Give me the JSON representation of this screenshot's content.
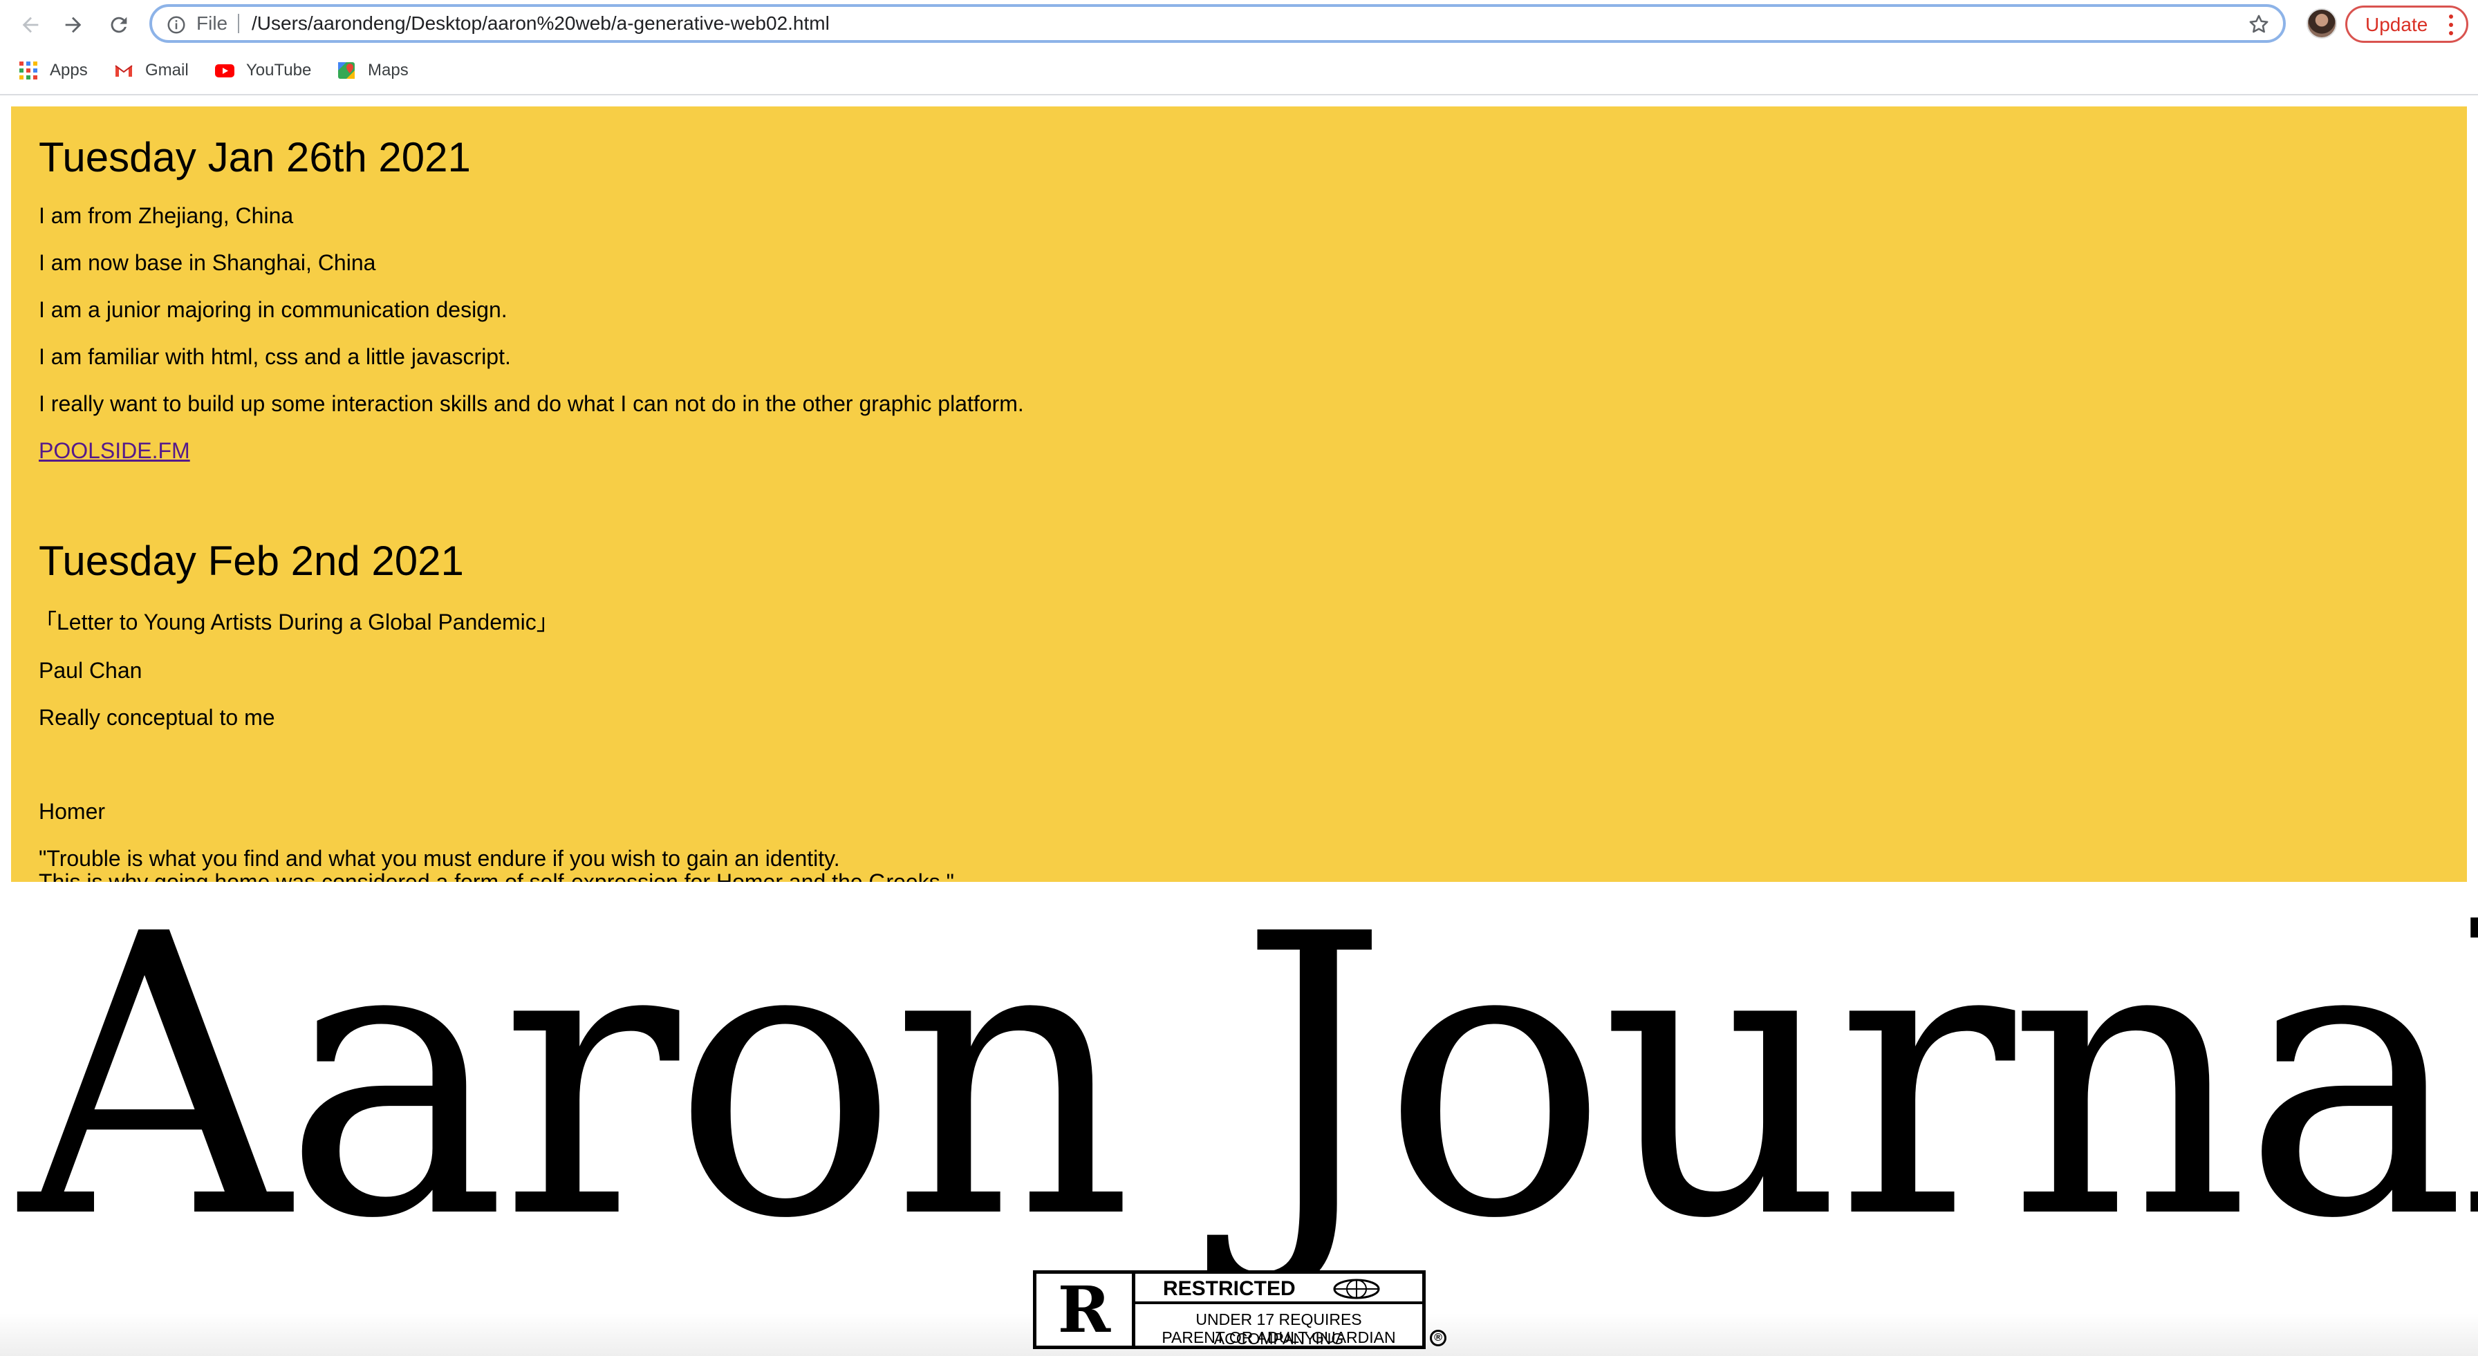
{
  "browser": {
    "omnibox": {
      "scheme_label": "File",
      "url": "/Users/aarondeng/Desktop/aaron%20web/a-generative-web02.html"
    },
    "update_label": "Update",
    "bookmarks": [
      {
        "label": "Apps",
        "icon": "apps-grid-icon"
      },
      {
        "label": "Gmail",
        "icon": "gmail-icon"
      },
      {
        "label": "YouTube",
        "icon": "youtube-icon"
      },
      {
        "label": "Maps",
        "icon": "maps-icon"
      }
    ]
  },
  "journal": {
    "entries": [
      {
        "date": "Tuesday Jan 26th 2021",
        "lines": [
          "I am from Zhejiang, China",
          "I am now base in Shanghai, China",
          "I am a junior majoring in communication design.",
          "I am familiar with html, css and a little javascript.",
          "I really want to build up some interaction skills and do what I can not do in the other graphic platform."
        ],
        "link": "POOLSIDE.FM"
      },
      {
        "date": "Tuesday Feb 2nd 2021",
        "lines": [
          "「Letter to Young Artists During a Global Pandemic」",
          "Paul Chan",
          "Really conceptual to me",
          "Homer",
          "\"Trouble is what you find and what you must endure if you wish to gain an identity.",
          "This is why going home was considered a form of self-expression for Homer and the Greeks.\""
        ]
      }
    ]
  },
  "hero_title": "Aaron Journal",
  "rating_badge": {
    "letter": "R",
    "heading": "RESTRICTED",
    "line1": "UNDER 17 REQUIRES ACCOMPANYING",
    "line2": "PARENT OR ADULT GUARDIAN",
    "registered": "®"
  },
  "colors": {
    "panel_background": "#f7ce46",
    "link": "#551a8b",
    "update_accent": "#d93025",
    "omnibox_focus": "#8db3e8"
  }
}
